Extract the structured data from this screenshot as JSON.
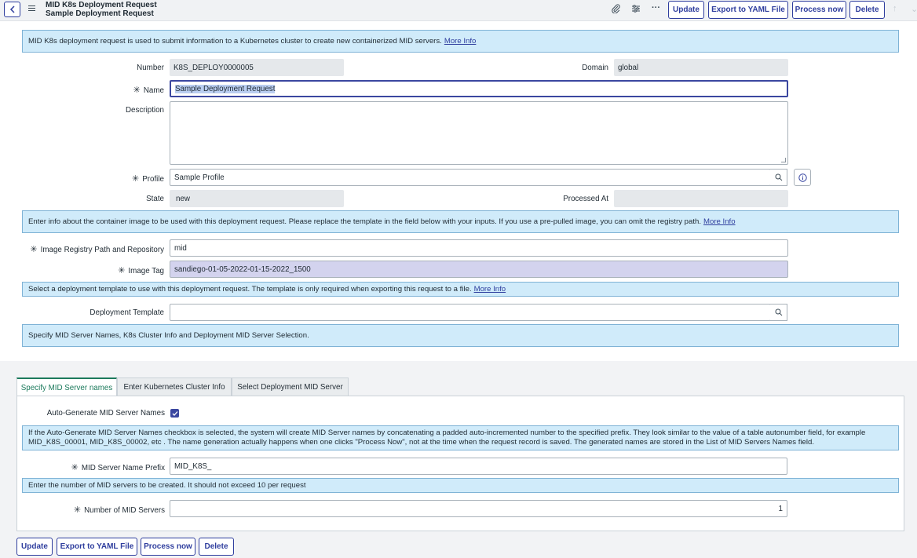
{
  "header": {
    "title_line1": "MID K8s Deployment Request",
    "title_line2": "Sample Deployment Request",
    "buttons": [
      "Update",
      "Export to YAML File",
      "Process now",
      "Delete"
    ]
  },
  "banners": {
    "intro": {
      "text": "MID K8s deployment request is used to submit information to a Kubernetes cluster to create new containerized MID servers.",
      "link": "More Info"
    },
    "image": {
      "text": "Enter info about the container image to be used with this deployment request. Please replace the template in the field below with your inputs. If you use a pre-pulled image, you can omit the registry path.",
      "link": "More Info"
    },
    "template": {
      "text": "Select a deployment template to use with this deployment request. The template is only required when exporting this request to a file.",
      "link": "More Info"
    },
    "specify": {
      "text": "Specify MID Server Names, K8s Cluster Info and Deployment MID Server Selection."
    }
  },
  "form": {
    "number": {
      "label": "Number",
      "value": "K8S_DEPLOY0000005"
    },
    "domain": {
      "label": "Domain",
      "value": "global"
    },
    "name": {
      "label": "Name",
      "value": "Sample Deployment Request"
    },
    "description": {
      "label": "Description",
      "value": ""
    },
    "profile": {
      "label": "Profile",
      "value": "Sample Profile"
    },
    "state": {
      "label": "State",
      "value": "new"
    },
    "processed_at": {
      "label": "Processed At",
      "value": ""
    },
    "image_registry": {
      "label": "Image Registry Path and Repository",
      "value": "mid"
    },
    "image_tag": {
      "label": "Image Tag",
      "value": "sandiego-01-05-2022-01-15-2022_1500"
    },
    "deployment_template": {
      "label": "Deployment Template",
      "value": ""
    }
  },
  "tabs": [
    {
      "label": "Specify MID Server names",
      "active": true
    },
    {
      "label": "Enter Kubernetes Cluster Info",
      "active": false
    },
    {
      "label": "Select Deployment MID Server",
      "active": false
    }
  ],
  "tab_panel": {
    "auto_generate": {
      "label": "Auto-Generate MID Server Names",
      "checked": true
    },
    "auto_info": {
      "line1": "If the Auto-Generate MID Server Names checkbox is selected, the system will create MID Server names by concatenating a padded auto-incremented number to the specified prefix. They look similar to the value of a table autonumber field, for example",
      "line2": "MID_K8S_00001, MID_K8S_00002, etc . The name generation actually happens when one clicks \"Process Now\", not at the time when the request record is saved. The generated names are stored in the List of MID Servers Names field."
    },
    "prefix": {
      "label": "MID Server Name Prefix",
      "value": "MID_K8S_"
    },
    "count_info": "Enter the number of MID servers to be created. It should not exceed 10 per request",
    "count": {
      "label": "Number of MID Servers",
      "value": "1"
    }
  },
  "footer_buttons": [
    "Update",
    "Export to YAML File",
    "Process now",
    "Delete"
  ],
  "colors": {
    "accent": "#2f3e9e",
    "banner_bg": "#d0ebfa",
    "active_tab": "#1c7a5c"
  }
}
